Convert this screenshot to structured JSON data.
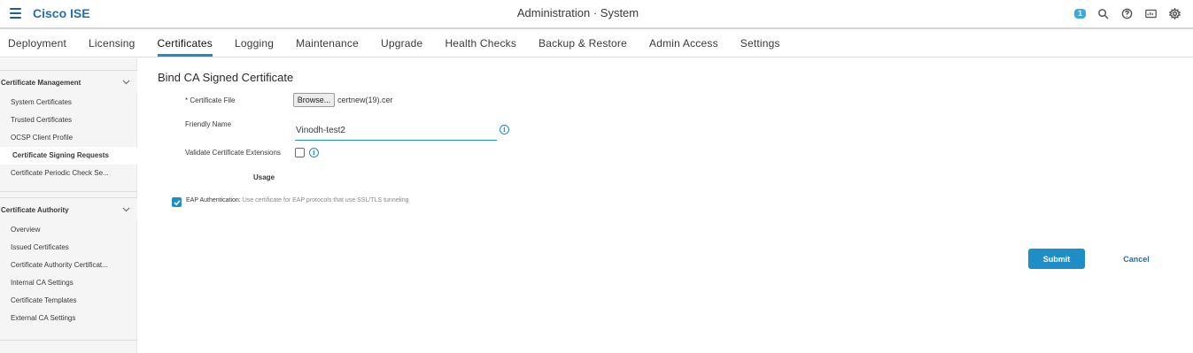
{
  "header": {
    "brand": "Cisco ISE",
    "title": "Administration · System",
    "notification_count": "1",
    "icons": [
      "search-icon",
      "help-icon",
      "dashboard-icon",
      "gear-icon"
    ]
  },
  "tabs": [
    {
      "label": "Deployment",
      "active": false
    },
    {
      "label": "Licensing",
      "active": false
    },
    {
      "label": "Certificates",
      "active": true
    },
    {
      "label": "Logging",
      "active": false
    },
    {
      "label": "Maintenance",
      "active": false
    },
    {
      "label": "Upgrade",
      "active": false
    },
    {
      "label": "Health Checks",
      "active": false
    },
    {
      "label": "Backup & Restore",
      "active": false
    },
    {
      "label": "Admin Access",
      "active": false
    },
    {
      "label": "Settings",
      "active": false
    }
  ],
  "sidebar": {
    "sections": [
      {
        "title": "Certificate Management",
        "items": [
          {
            "label": "System Certificates",
            "active": false
          },
          {
            "label": "Trusted Certificates",
            "active": false
          },
          {
            "label": "OCSP Client Profile",
            "active": false
          },
          {
            "label": "Certificate Signing Requests",
            "active": true
          },
          {
            "label": "Certificate Periodic Check Se...",
            "active": false
          }
        ]
      },
      {
        "title": "Certificate Authority",
        "items": [
          {
            "label": "Overview",
            "active": false
          },
          {
            "label": "Issued Certificates",
            "active": false
          },
          {
            "label": "Certificate Authority Certificat...",
            "active": false
          },
          {
            "label": "Internal CA Settings",
            "active": false
          },
          {
            "label": "Certificate Templates",
            "active": false
          },
          {
            "label": "External CA Settings",
            "active": false
          }
        ]
      }
    ]
  },
  "form": {
    "title": "Bind CA Signed Certificate",
    "certificate_file_label": "* Certificate File",
    "browse_label": "Browse...",
    "file_name": "certnew(19).cer",
    "friendly_name_label": "Friendly Name",
    "friendly_name_value": "Vinodh-test2",
    "validate_label": "Validate Certificate Extensions",
    "validate_checked": false,
    "usage_label": "Usage",
    "eap_label": "EAP Authentication:",
    "eap_description": "Use certificate for EAP protocols that use SSL/TLS tunneling",
    "eap_checked": true,
    "submit_label": "Submit",
    "cancel_label": "Cancel"
  },
  "colors": {
    "accent": "#1f8dc8",
    "brand": "#1f6fb5"
  }
}
